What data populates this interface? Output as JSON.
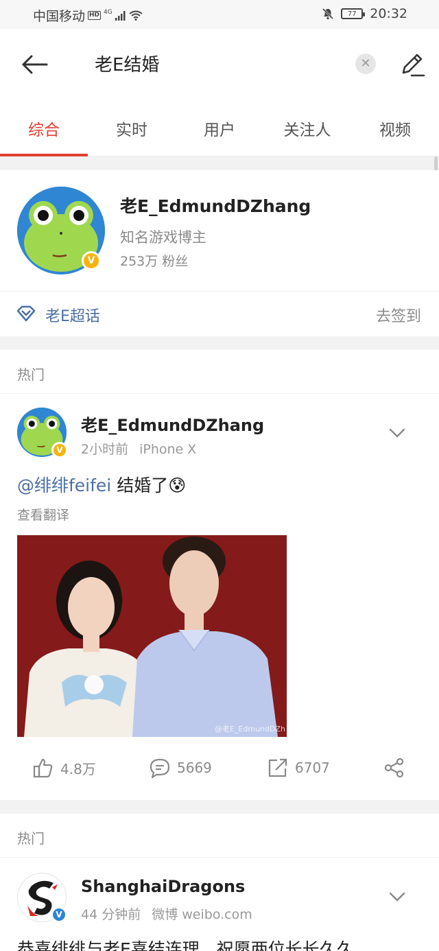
{
  "status_bar": {
    "carrier": "中国移动",
    "hd": "HD",
    "network": "4G",
    "battery": "77",
    "time": "20:32"
  },
  "search": {
    "query": "老E结婚",
    "clear_symbol": "✕"
  },
  "tabs": [
    {
      "label": "综合",
      "active": true
    },
    {
      "label": "实时",
      "active": false
    },
    {
      "label": "用户",
      "active": false
    },
    {
      "label": "关注人",
      "active": false
    },
    {
      "label": "视频",
      "active": false
    }
  ],
  "user_card": {
    "name": "老E_EdmundDZhang",
    "description": "知名游戏博主",
    "fans": "253万 粉丝",
    "verified_mark": "V",
    "topic_label": "老E超话",
    "checkin_label": "去签到"
  },
  "sections": [
    {
      "label": "热门"
    },
    {
      "label": "热门"
    }
  ],
  "posts": [
    {
      "author": "老E_EdmundDZhang",
      "time": "2小时前",
      "device": "iPhone X",
      "mention": "@绯绯feifei",
      "text": " 结婚了",
      "emoji": "😰",
      "translate": "查看翻译",
      "watermark": "@老E_EdmundDZh",
      "likes": "4.8万",
      "comments": "5669",
      "reposts": "6707"
    },
    {
      "author": "ShanghaiDragons",
      "time": "44 分钟前",
      "device": "微博 weibo.com",
      "text": "恭喜绯绯与老E喜结连理，祝愿两位长长久久"
    }
  ],
  "colors": {
    "accent": "#e2402f",
    "link": "#4a6fa5",
    "verified": "#f5b40c"
  },
  "icons": [
    "back-arrow-icon",
    "clear-icon",
    "edit-pencil-icon",
    "super-topic-icon",
    "chevron-down-icon",
    "like-icon",
    "comment-icon",
    "repost-icon",
    "share-icon"
  ]
}
